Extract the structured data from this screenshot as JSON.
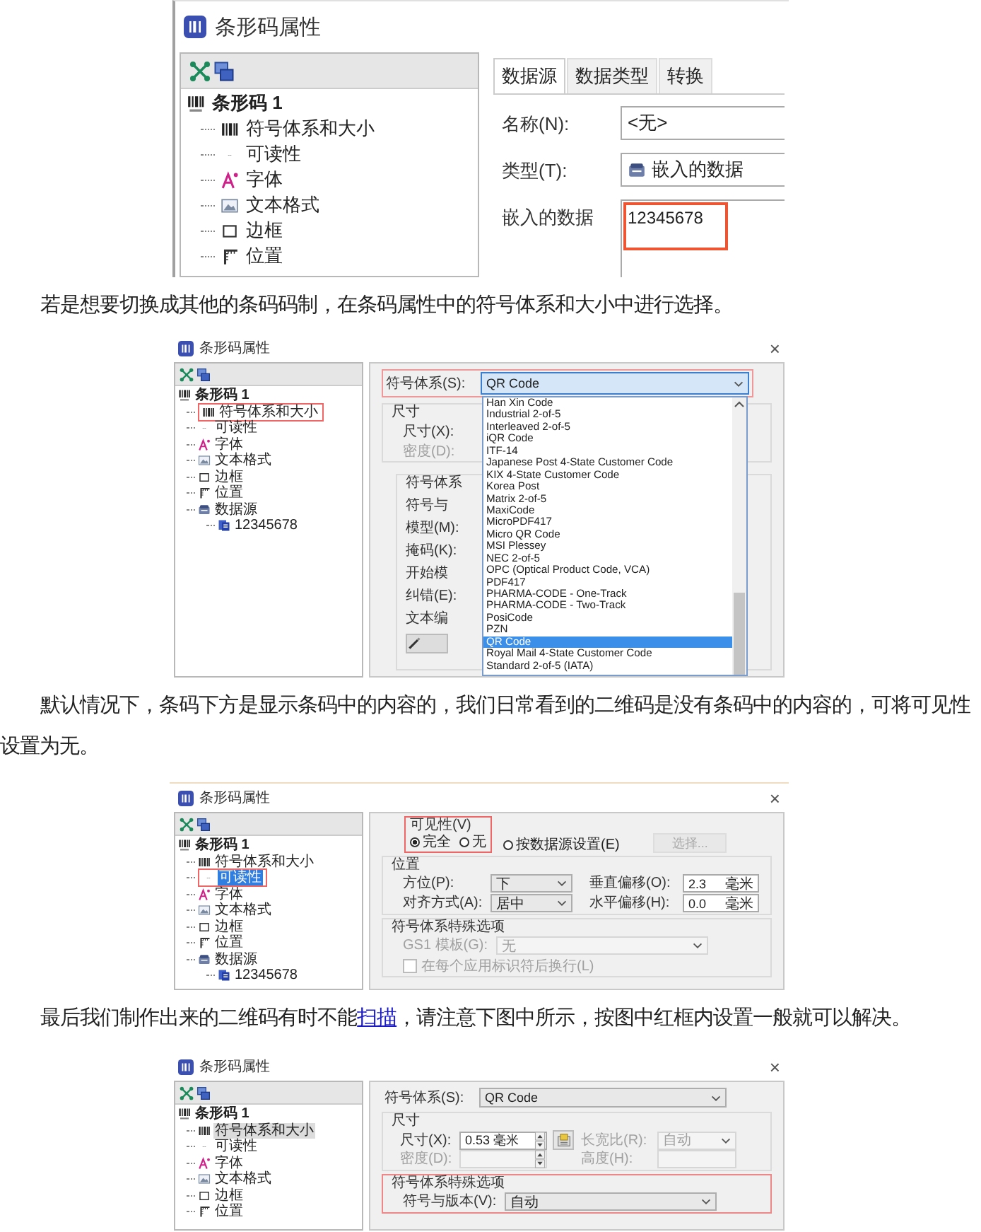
{
  "article": [
    {
      "kind": "dialog",
      "title": "条形码属性",
      "tree": {
        "label": "条形码 1",
        "children": [
          {
            "kind": "symbology",
            "label": "符号体系和大小",
            "selected": false,
            "highlighted": false
          },
          {
            "kind": "readability",
            "label": "可读性",
            "selected": false,
            "highlighted": false
          },
          {
            "kind": "font",
            "label": "字体",
            "selected": false,
            "highlighted": false
          },
          {
            "kind": "text-format",
            "label": "文本格式",
            "selected": false,
            "highlighted": false
          },
          {
            "kind": "border",
            "label": "边框",
            "selected": false,
            "highlighted": false
          },
          {
            "kind": "position",
            "label": "位置",
            "selected": false,
            "highlighted": false
          }
        ]
      },
      "panel": {
        "kind": "data-source",
        "tabs": [
          {
            "label": "数据源",
            "selected": true
          },
          {
            "label": "数据类型",
            "selected": false
          },
          {
            "label": "转换",
            "selected": false
          }
        ],
        "fields": [
          {
            "kind": "text",
            "label": "名称(N):",
            "value": "<无>"
          },
          {
            "kind": "typed",
            "label": "类型(T):",
            "value": "嵌入的数据"
          }
        ],
        "content": {
          "label": "嵌入的数据",
          "value": "12345678",
          "highlighted": true
        }
      }
    },
    {
      "kind": "paragraph",
      "parts": [
        {
          "text": "若是想要切换成其他的条码码制，在条码属性中的符号体系和大小中进行选择。",
          "link": false
        }
      ]
    },
    {
      "kind": "dialog",
      "title": "条形码属性",
      "close": "×",
      "tree": {
        "label": "条形码 1",
        "children": [
          {
            "kind": "symbology",
            "label": "符号体系和大小",
            "selected": false,
            "highlighted": true
          },
          {
            "kind": "readability",
            "label": "可读性",
            "selected": false,
            "highlighted": false
          },
          {
            "kind": "font",
            "label": "字体",
            "selected": false,
            "highlighted": false
          },
          {
            "kind": "text-format",
            "label": "文本格式",
            "selected": false,
            "highlighted": false
          },
          {
            "kind": "border",
            "label": "边框",
            "selected": false,
            "highlighted": false
          },
          {
            "kind": "position",
            "label": "位置",
            "selected": false,
            "highlighted": false
          },
          {
            "kind": "data-source",
            "label": "数据源",
            "selected": false,
            "highlighted": false,
            "children": [
              {
                "kind": "data",
                "label": "12345678",
                "selected": false,
                "highlighted": false
              }
            ]
          }
        ]
      },
      "panel": {
        "kind": "symbology-list",
        "symbology": {
          "label": "符号体系(S):",
          "value": "QR Code",
          "highlighted": true
        },
        "size_group": {
          "title": "尺寸",
          "rows": [
            {
              "label": "尺寸(X):",
              "disabled": false
            },
            {
              "label": "密度(D):",
              "disabled": true
            }
          ]
        },
        "inner_group": {
          "title": "符号体系",
          "labels": [
            "符号与",
            "模型(M):",
            "掩码(K):",
            "开始模",
            "纠错(E):",
            "文本编"
          ]
        },
        "options": [
          {
            "label": "Han Xin Code",
            "selected": false
          },
          {
            "label": "Industrial 2-of-5",
            "selected": false
          },
          {
            "label": "Interleaved 2-of-5",
            "selected": false
          },
          {
            "label": "iQR Code",
            "selected": false
          },
          {
            "label": "ITF-14",
            "selected": false
          },
          {
            "label": "Japanese Post 4-State Customer Code",
            "selected": false
          },
          {
            "label": "KIX 4-State Customer Code",
            "selected": false
          },
          {
            "label": "Korea Post",
            "selected": false
          },
          {
            "label": "Matrix 2-of-5",
            "selected": false
          },
          {
            "label": "MaxiCode",
            "selected": false
          },
          {
            "label": "MicroPDF417",
            "selected": false
          },
          {
            "label": "Micro QR Code",
            "selected": false
          },
          {
            "label": "MSI Plessey",
            "selected": false
          },
          {
            "label": "NEC 2-of-5",
            "selected": false
          },
          {
            "label": "OPC (Optical Product Code, VCA)",
            "selected": false
          },
          {
            "label": "PDF417",
            "selected": false
          },
          {
            "label": "PHARMA-CODE - One-Track",
            "selected": false
          },
          {
            "label": "PHARMA-CODE - Two-Track",
            "selected": false
          },
          {
            "label": "PosiCode",
            "selected": false
          },
          {
            "label": "PZN",
            "selected": false
          },
          {
            "label": "QR Code",
            "selected": true
          },
          {
            "label": "Royal Mail 4-State Customer Code",
            "selected": false
          },
          {
            "label": "Standard 2-of-5 (IATA)",
            "selected": false
          }
        ]
      }
    },
    {
      "kind": "paragraph",
      "parts": [
        {
          "text": "默认情况下，条码下方是显示条码中的内容的，我们日常看到的二维码是没有条码中的内容的，可将可见性设置为无。",
          "link": false
        }
      ]
    },
    {
      "kind": "dialog",
      "title": "条形码属性",
      "close": "×",
      "tree": {
        "label": "条形码 1",
        "focused": true,
        "children": [
          {
            "kind": "symbology",
            "label": "符号体系和大小",
            "selected": false,
            "highlighted": false
          },
          {
            "kind": "readability",
            "label": "可读性",
            "selected": true,
            "highlighted": true
          },
          {
            "kind": "font",
            "label": "字体",
            "selected": false,
            "highlighted": false
          },
          {
            "kind": "text-format",
            "label": "文本格式",
            "selected": false,
            "highlighted": false
          },
          {
            "kind": "border",
            "label": "边框",
            "selected": false,
            "highlighted": false
          },
          {
            "kind": "position",
            "label": "位置",
            "selected": false,
            "highlighted": false
          },
          {
            "kind": "data-source",
            "label": "数据源",
            "selected": false,
            "highlighted": false,
            "children": [
              {
                "kind": "data",
                "label": "12345678",
                "selected": false,
                "highlighted": false
              }
            ]
          }
        ]
      },
      "panel": {
        "kind": "readability",
        "visibility": {
          "title": "可见性(V)",
          "highlighted": true,
          "options": [
            {
              "label": "完全",
              "selected": true
            },
            {
              "label": "无",
              "selected": false
            }
          ],
          "source_option": {
            "label": "按数据源设置(E)",
            "selected": false
          },
          "button": {
            "label": "选择...",
            "disabled": true
          }
        },
        "groups": [
          {
            "title": "位置",
            "highlighted": false,
            "rows": [
              [
                {
                  "kind": "dropdown",
                  "label": "方位(P):",
                  "value": "下",
                  "disabled": false
                },
                {
                  "kind": "input",
                  "label": "垂直偏移(O):",
                  "value": "2.3",
                  "unit": "毫米",
                  "disabled": false
                }
              ],
              [
                {
                  "kind": "dropdown",
                  "label": "对齐方式(A):",
                  "value": "居中",
                  "disabled": false
                },
                {
                  "kind": "input",
                  "label": "水平偏移(H):",
                  "value": "0.0",
                  "unit": "毫米",
                  "disabled": false
                }
              ]
            ]
          },
          {
            "title": "符号体系特殊选项",
            "highlighted": false,
            "rows": [
              [
                {
                  "kind": "dropdown",
                  "label": "GS1 模板(G):",
                  "value": "无",
                  "disabled": true
                }
              ],
              [
                {
                  "kind": "checkbox",
                  "label": "在每个应用标识符后换行(L)",
                  "checked": false,
                  "disabled": true
                }
              ]
            ]
          }
        ]
      }
    },
    {
      "kind": "paragraph",
      "parts": [
        {
          "text": "最后我们制作出来的二维码有时不能",
          "link": false
        },
        {
          "text": "扫描",
          "link": true
        },
        {
          "text": "，请注意下图中所示，按图中红框内设置一般就可以解决。",
          "link": false
        }
      ]
    },
    {
      "kind": "dialog",
      "title": "条形码属性",
      "close": "×",
      "tree": {
        "label": "条形码 1",
        "focused": false,
        "children": [
          {
            "kind": "symbology",
            "label": "符号体系和大小",
            "selected": true,
            "highlighted": false
          },
          {
            "kind": "readability",
            "label": "可读性",
            "selected": false,
            "highlighted": false
          },
          {
            "kind": "font",
            "label": "字体",
            "selected": false,
            "highlighted": false
          },
          {
            "kind": "text-format",
            "label": "文本格式",
            "selected": false,
            "highlighted": false
          },
          {
            "kind": "border",
            "label": "边框",
            "selected": false,
            "highlighted": false
          },
          {
            "kind": "position",
            "label": "位置",
            "selected": false,
            "highlighted": false
          }
        ]
      },
      "panel": {
        "kind": "symbology-size",
        "symbology": {
          "label": "符号体系(S):",
          "value": "QR Code",
          "highlighted": false
        },
        "groups": [
          {
            "title": "尺寸",
            "highlighted": false,
            "rows": [
              [
                {
                  "kind": "spinner",
                  "label": "尺寸(X):",
                  "value": "0.53 毫米",
                  "disabled": false
                },
                {
                  "kind": "icon-button"
                },
                {
                  "kind": "dropdown",
                  "label": "长宽比(R):",
                  "value": "自动",
                  "disabled": true
                }
              ],
              [
                {
                  "kind": "spinner",
                  "label": "密度(D):",
                  "disabled": true
                },
                {
                  "kind": "input",
                  "label": "高度(H):",
                  "disabled": true
                }
              ]
            ]
          },
          {
            "title": "符号体系特殊选项",
            "highlighted": true,
            "rows": [
              [
                {
                  "kind": "dropdown",
                  "label": "符号与版本(V):",
                  "value": "自动",
                  "disabled": false
                }
              ]
            ]
          }
        ]
      }
    }
  ]
}
